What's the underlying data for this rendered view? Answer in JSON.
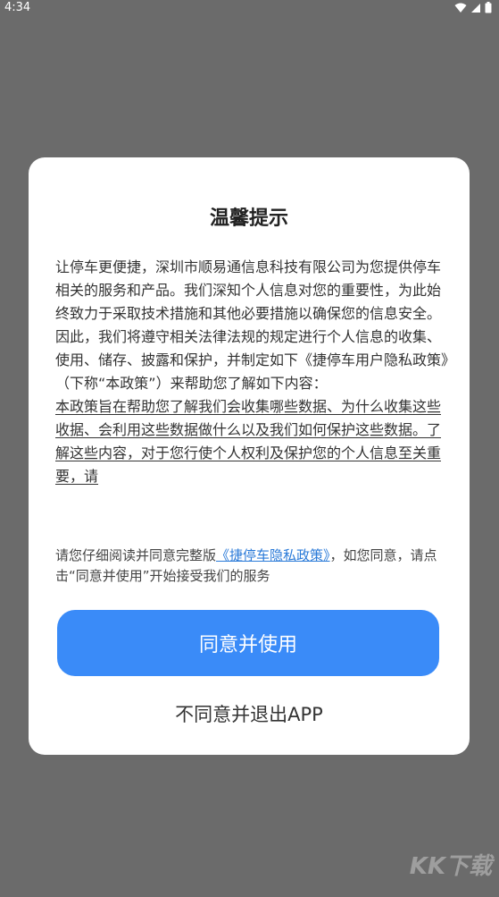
{
  "status_bar": {
    "time": "4:34",
    "icons": [
      "wifi-icon",
      "signal-icon",
      "battery-icon"
    ]
  },
  "dialog": {
    "title": "温馨提示",
    "body_paragraph": "让停车更便捷，深圳市顺易通信息科技有限公司为您提供停车相关的服务和产品。我们深知个人信息对您的重要性，为此始终致力于采取技术措施和其他必要措施以确保您的信息安全。因此，我们将遵守相关法律法规的规定进行个人信息的收集、使用、储存、披露和保护，并制定如下《捷停车用户隐私政策》（下称“本政策”）来帮助您了解如下内容：",
    "body_underlined": " 本政策旨在帮助您了解我们会收集哪些数据、为什么收集这些收据、会利用这些数据做什么以及我们如何保护这些数据。了解这些内容，对于您行使个人权利及保护您的个人信息至关重要，请",
    "notice_prefix": "请您仔细阅读并同意完整版",
    "notice_link": "《捷停车隐私政策》",
    "notice_suffix": "，如您同意，请点击“同意并使用”开始接受我们的服务",
    "agree_button": "同意并使用",
    "disagree_button": "不同意并退出APP"
  },
  "watermark": "KK下载",
  "colors": {
    "overlay": "#6b6b6b",
    "primary_button": "#3a8bf8",
    "link": "#2a7ad8"
  }
}
